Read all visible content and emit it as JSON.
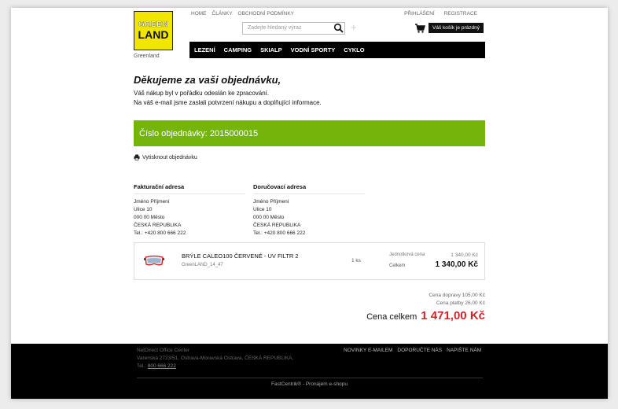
{
  "logo": {
    "line1": "GREEN",
    "line2": "LAND",
    "caption": "Greenland"
  },
  "topnav": [
    "HOME",
    "ČLÁNKY",
    "OBCHODNÍ PODMÍNKY"
  ],
  "account": {
    "login": "PŘIHLÁŠENÍ",
    "register": "REGISTRACE"
  },
  "search": {
    "placeholder": "Zadejte hledaný výraz"
  },
  "cart": {
    "label": "Váš košík je prázdný"
  },
  "mainnav": [
    "LEZENÍ",
    "CAMPING",
    "SKIALP",
    "VODNÍ SPORTY",
    "CYKLO"
  ],
  "thanks": {
    "title": "Děkujeme za vaši objednávku,",
    "line1": "Váš nákup byl v pořádku odeslán ke zpracování.",
    "line2": "Na váš e-mail jsme zaslali potvrzení nákupu a doplňující informace."
  },
  "order": {
    "number_label": "Číslo objednávky: 2015000015"
  },
  "print_label": "Vytisknout objednávku",
  "billing": {
    "title": "Fakturační adresa",
    "lines": [
      "Jméno Příjmení",
      "Ulice 10",
      "000 00 Město",
      "ČESKÁ REPUBLIKA",
      "Tel.: +420 800 666 222"
    ]
  },
  "shipping": {
    "title": "Doručovací adresa",
    "lines": [
      "Jméno Příjmení",
      "Ulice 10",
      "000 00 Město",
      "ČESKÁ REPUBLIKA",
      "Tel.: +420 800 666 222"
    ]
  },
  "item": {
    "name": "BRÝLE CALEO100 ČERVENÉ - UV FILTR 2",
    "code": "GreenLAND_14_47",
    "qty": "1 ks",
    "unit_label": "Jednotková cena",
    "unit_price": "1 340,00 Kč",
    "total_label": "Celkem",
    "total_price": "1 340,00 Kč"
  },
  "totals": {
    "shipping": "Cena dopravy   105,00 Kč",
    "payment": "Cena platby   26,00 Kč",
    "grand_label": "Cena celkem",
    "grand_value": "1 471,00 Kč"
  },
  "footer": {
    "company": "NetDirect   Office Center",
    "address": "Varenská 2723/51,  Ostrava-Moravská Ostrava,  ČESKÁ REPUBLIKA,",
    "tel_label": "Tel.:",
    "tel": "800 666 222",
    "links": [
      "NOVINKY E-MAILEM",
      "DOPORUČTE NÁS",
      "NAPIŠTE NÁM"
    ],
    "bottom": "FastCentrik® - Pronájem e-shopu"
  }
}
